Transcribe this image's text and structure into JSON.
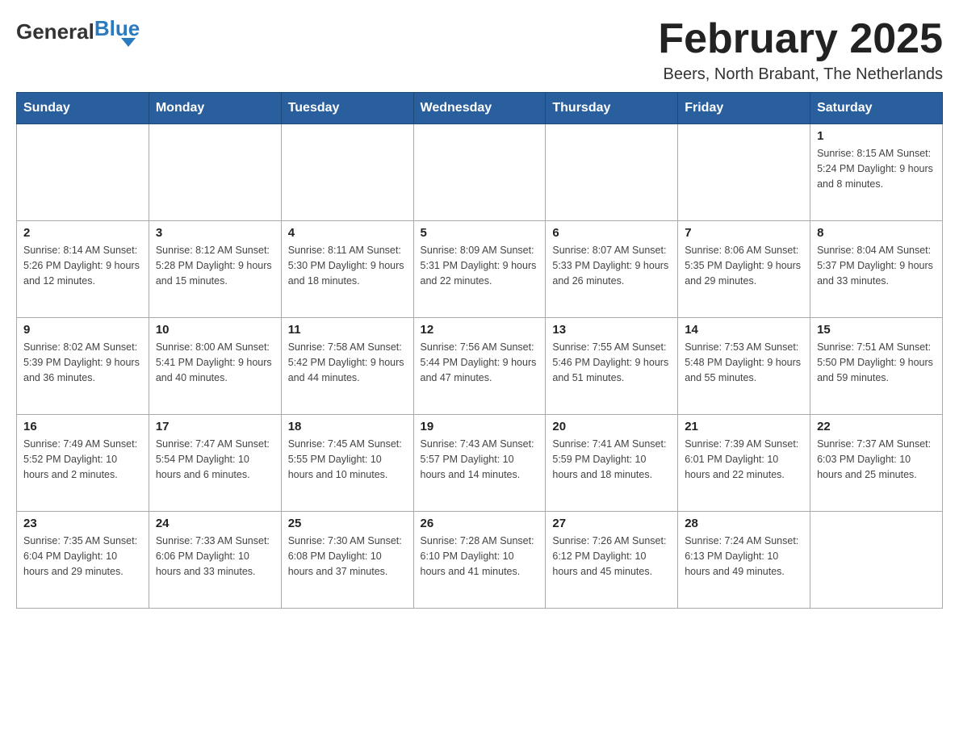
{
  "header": {
    "logo_general": "General",
    "logo_blue": "Blue",
    "title": "February 2025",
    "subtitle": "Beers, North Brabant, The Netherlands"
  },
  "days_of_week": [
    "Sunday",
    "Monday",
    "Tuesday",
    "Wednesday",
    "Thursday",
    "Friday",
    "Saturday"
  ],
  "weeks": [
    {
      "days": [
        {
          "num": "",
          "info": ""
        },
        {
          "num": "",
          "info": ""
        },
        {
          "num": "",
          "info": ""
        },
        {
          "num": "",
          "info": ""
        },
        {
          "num": "",
          "info": ""
        },
        {
          "num": "",
          "info": ""
        },
        {
          "num": "1",
          "info": "Sunrise: 8:15 AM\nSunset: 5:24 PM\nDaylight: 9 hours and 8 minutes."
        }
      ]
    },
    {
      "days": [
        {
          "num": "2",
          "info": "Sunrise: 8:14 AM\nSunset: 5:26 PM\nDaylight: 9 hours and 12 minutes."
        },
        {
          "num": "3",
          "info": "Sunrise: 8:12 AM\nSunset: 5:28 PM\nDaylight: 9 hours and 15 minutes."
        },
        {
          "num": "4",
          "info": "Sunrise: 8:11 AM\nSunset: 5:30 PM\nDaylight: 9 hours and 18 minutes."
        },
        {
          "num": "5",
          "info": "Sunrise: 8:09 AM\nSunset: 5:31 PM\nDaylight: 9 hours and 22 minutes."
        },
        {
          "num": "6",
          "info": "Sunrise: 8:07 AM\nSunset: 5:33 PM\nDaylight: 9 hours and 26 minutes."
        },
        {
          "num": "7",
          "info": "Sunrise: 8:06 AM\nSunset: 5:35 PM\nDaylight: 9 hours and 29 minutes."
        },
        {
          "num": "8",
          "info": "Sunrise: 8:04 AM\nSunset: 5:37 PM\nDaylight: 9 hours and 33 minutes."
        }
      ]
    },
    {
      "days": [
        {
          "num": "9",
          "info": "Sunrise: 8:02 AM\nSunset: 5:39 PM\nDaylight: 9 hours and 36 minutes."
        },
        {
          "num": "10",
          "info": "Sunrise: 8:00 AM\nSunset: 5:41 PM\nDaylight: 9 hours and 40 minutes."
        },
        {
          "num": "11",
          "info": "Sunrise: 7:58 AM\nSunset: 5:42 PM\nDaylight: 9 hours and 44 minutes."
        },
        {
          "num": "12",
          "info": "Sunrise: 7:56 AM\nSunset: 5:44 PM\nDaylight: 9 hours and 47 minutes."
        },
        {
          "num": "13",
          "info": "Sunrise: 7:55 AM\nSunset: 5:46 PM\nDaylight: 9 hours and 51 minutes."
        },
        {
          "num": "14",
          "info": "Sunrise: 7:53 AM\nSunset: 5:48 PM\nDaylight: 9 hours and 55 minutes."
        },
        {
          "num": "15",
          "info": "Sunrise: 7:51 AM\nSunset: 5:50 PM\nDaylight: 9 hours and 59 minutes."
        }
      ]
    },
    {
      "days": [
        {
          "num": "16",
          "info": "Sunrise: 7:49 AM\nSunset: 5:52 PM\nDaylight: 10 hours and 2 minutes."
        },
        {
          "num": "17",
          "info": "Sunrise: 7:47 AM\nSunset: 5:54 PM\nDaylight: 10 hours and 6 minutes."
        },
        {
          "num": "18",
          "info": "Sunrise: 7:45 AM\nSunset: 5:55 PM\nDaylight: 10 hours and 10 minutes."
        },
        {
          "num": "19",
          "info": "Sunrise: 7:43 AM\nSunset: 5:57 PM\nDaylight: 10 hours and 14 minutes."
        },
        {
          "num": "20",
          "info": "Sunrise: 7:41 AM\nSunset: 5:59 PM\nDaylight: 10 hours and 18 minutes."
        },
        {
          "num": "21",
          "info": "Sunrise: 7:39 AM\nSunset: 6:01 PM\nDaylight: 10 hours and 22 minutes."
        },
        {
          "num": "22",
          "info": "Sunrise: 7:37 AM\nSunset: 6:03 PM\nDaylight: 10 hours and 25 minutes."
        }
      ]
    },
    {
      "days": [
        {
          "num": "23",
          "info": "Sunrise: 7:35 AM\nSunset: 6:04 PM\nDaylight: 10 hours and 29 minutes."
        },
        {
          "num": "24",
          "info": "Sunrise: 7:33 AM\nSunset: 6:06 PM\nDaylight: 10 hours and 33 minutes."
        },
        {
          "num": "25",
          "info": "Sunrise: 7:30 AM\nSunset: 6:08 PM\nDaylight: 10 hours and 37 minutes."
        },
        {
          "num": "26",
          "info": "Sunrise: 7:28 AM\nSunset: 6:10 PM\nDaylight: 10 hours and 41 minutes."
        },
        {
          "num": "27",
          "info": "Sunrise: 7:26 AM\nSunset: 6:12 PM\nDaylight: 10 hours and 45 minutes."
        },
        {
          "num": "28",
          "info": "Sunrise: 7:24 AM\nSunset: 6:13 PM\nDaylight: 10 hours and 49 minutes."
        },
        {
          "num": "",
          "info": ""
        }
      ]
    }
  ]
}
